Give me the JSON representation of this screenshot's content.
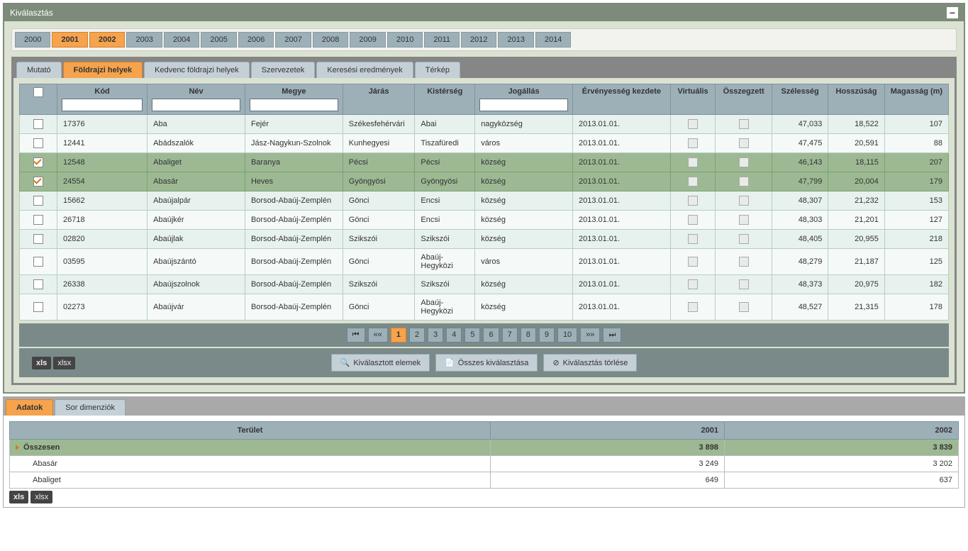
{
  "panel": {
    "title": "Kiválasztás"
  },
  "years": [
    "2000",
    "2001",
    "2002",
    "2003",
    "2004",
    "2005",
    "2006",
    "2007",
    "2008",
    "2009",
    "2010",
    "2011",
    "2012",
    "2013",
    "2014"
  ],
  "years_selected": [
    "2001",
    "2002"
  ],
  "tabs": {
    "items": [
      "Mutató",
      "Földrajzi helyek",
      "Kedvenc földrajzi helyek",
      "Szervezetek",
      "Keresési eredmények",
      "Térkép"
    ],
    "active": "Földrajzi helyek"
  },
  "grid": {
    "headers": {
      "kod": "Kód",
      "nev": "Név",
      "megye": "Megye",
      "jaras": "Járás",
      "kisterseg": "Kistérség",
      "jogallas": "Jogállás",
      "erv": "Érvényesség kezdete",
      "virtualis": "Virtuális",
      "osszegzett": "Összegzett",
      "szelesseg": "Szélesség",
      "hosszusag": "Hosszúság",
      "magassag": "Magasság (m)"
    },
    "rows": [
      {
        "sel": false,
        "kod": "17376",
        "nev": "Aba",
        "megye": "Fejér",
        "jaras": "Székesfehérvári",
        "kist": "Abai",
        "jog": "nagyközség",
        "erv": "2013.01.01.",
        "sz": "47,033",
        "ho": "18,522",
        "mag": "107"
      },
      {
        "sel": false,
        "kod": "12441",
        "nev": "Abádszalók",
        "megye": "Jász-Nagykun-Szolnok",
        "jaras": "Kunhegyesi",
        "kist": "Tiszafüredi",
        "jog": "város",
        "erv": "2013.01.01.",
        "sz": "47,475",
        "ho": "20,591",
        "mag": "88"
      },
      {
        "sel": true,
        "kod": "12548",
        "nev": "Abaliget",
        "megye": "Baranya",
        "jaras": "Pécsi",
        "kist": "Pécsi",
        "jog": "község",
        "erv": "2013.01.01.",
        "sz": "46,143",
        "ho": "18,115",
        "mag": "207"
      },
      {
        "sel": true,
        "kod": "24554",
        "nev": "Abasár",
        "megye": "Heves",
        "jaras": "Gyöngyösi",
        "kist": "Gyöngyösi",
        "jog": "község",
        "erv": "2013.01.01.",
        "sz": "47,799",
        "ho": "20,004",
        "mag": "179"
      },
      {
        "sel": false,
        "kod": "15662",
        "nev": "Abaújalpár",
        "megye": "Borsod-Abaúj-Zemplén",
        "jaras": "Gönci",
        "kist": "Encsi",
        "jog": "község",
        "erv": "2013.01.01.",
        "sz": "48,307",
        "ho": "21,232",
        "mag": "153"
      },
      {
        "sel": false,
        "kod": "26718",
        "nev": "Abaújkér",
        "megye": "Borsod-Abaúj-Zemplén",
        "jaras": "Gönci",
        "kist": "Encsi",
        "jog": "község",
        "erv": "2013.01.01.",
        "sz": "48,303",
        "ho": "21,201",
        "mag": "127"
      },
      {
        "sel": false,
        "kod": "02820",
        "nev": "Abaújlak",
        "megye": "Borsod-Abaúj-Zemplén",
        "jaras": "Szikszói",
        "kist": "Szikszói",
        "jog": "község",
        "erv": "2013.01.01.",
        "sz": "48,405",
        "ho": "20,955",
        "mag": "218"
      },
      {
        "sel": false,
        "kod": "03595",
        "nev": "Abaújszántó",
        "megye": "Borsod-Abaúj-Zemplén",
        "jaras": "Gönci",
        "kist": "Abaúj-Hegyközi",
        "jog": "város",
        "erv": "2013.01.01.",
        "sz": "48,279",
        "ho": "21,187",
        "mag": "125"
      },
      {
        "sel": false,
        "kod": "26338",
        "nev": "Abaújszolnok",
        "megye": "Borsod-Abaúj-Zemplén",
        "jaras": "Szikszói",
        "kist": "Szikszói",
        "jog": "község",
        "erv": "2013.01.01.",
        "sz": "48,373",
        "ho": "20,975",
        "mag": "182"
      },
      {
        "sel": false,
        "kod": "02273",
        "nev": "Abaújvár",
        "megye": "Borsod-Abaúj-Zemplén",
        "jaras": "Gönci",
        "kist": "Abaúj-Hegyközi",
        "jog": "község",
        "erv": "2013.01.01.",
        "sz": "48,527",
        "ho": "21,315",
        "mag": "178"
      }
    ]
  },
  "pager": {
    "first": "⏮",
    "prev": "◀◀",
    "next": "▶▶",
    "last": "⏭",
    "pages": [
      "1",
      "2",
      "3",
      "4",
      "5",
      "6",
      "7",
      "8",
      "9",
      "10"
    ],
    "active": "1"
  },
  "export": {
    "xls": "xls",
    "xlsx": "xlsx"
  },
  "actions": {
    "selected_items": "Kiválasztott elemek",
    "select_all": "Összes kiválasztása",
    "clear_selection": "Kiválasztás törlése"
  },
  "bottom": {
    "tabs": {
      "items": [
        "Adatok",
        "Sor dimenziók"
      ],
      "active": "Adatok"
    },
    "headers": {
      "terulet": "Terület",
      "y1": "2001",
      "y2": "2002"
    },
    "total_label": "Összesen",
    "total": {
      "y1": "3 898",
      "y2": "3 839"
    },
    "rows": [
      {
        "name": "Abasár",
        "y1": "3 249",
        "y2": "3 202"
      },
      {
        "name": "Abaliget",
        "y1": "649",
        "y2": "637"
      }
    ]
  }
}
